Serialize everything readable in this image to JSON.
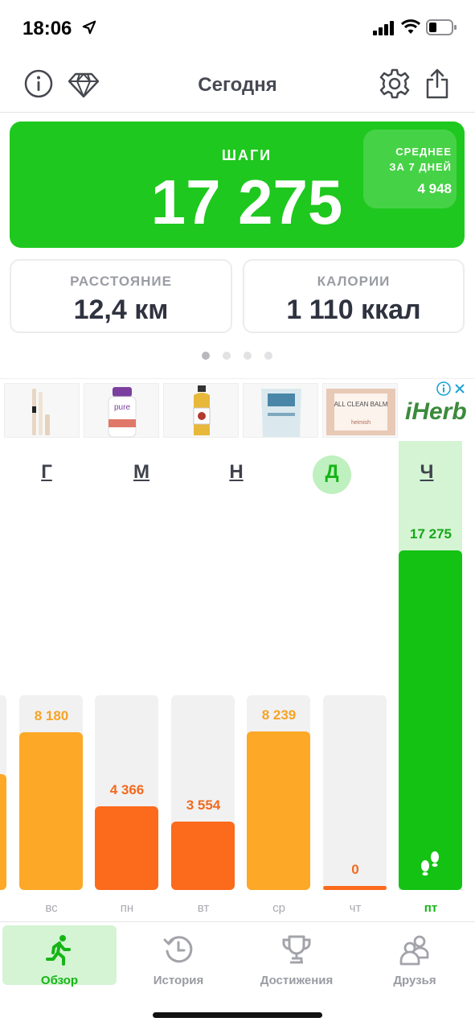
{
  "status_bar": {
    "time": "18:06"
  },
  "nav": {
    "title": "Сегодня"
  },
  "steps": {
    "label": "ШАГИ",
    "value": "17 275",
    "avg_label_line1": "СРЕДНЕЕ",
    "avg_label_line2": "ЗА 7 ДНЕЙ",
    "avg_value": "4 948"
  },
  "stats": [
    {
      "label": "РАССТОЯНИЕ",
      "value": "12,4 км"
    },
    {
      "label": "КАЛОРИИ",
      "value": "1 110 ккал"
    }
  ],
  "pager": {
    "pages": 4,
    "active_index": 0
  },
  "ad": {
    "brand": "iHerb",
    "product_texts": [
      "pure",
      "ALL CLEAN BALM",
      "heimish"
    ]
  },
  "chart": {
    "week_letters": [
      "Г",
      "М",
      "Н",
      "Д",
      "Ч"
    ],
    "highlighted_letter_index": 3
  },
  "chart_data": {
    "type": "bar",
    "categories": [
      "вс",
      "пн",
      "вт",
      "ср",
      "чт",
      "пт"
    ],
    "values": [
      8180,
      4366,
      3554,
      8239,
      0,
      17275
    ],
    "value_labels": [
      "8 180",
      "4 366",
      "3 554",
      "8 239",
      "0",
      "17 275"
    ],
    "highlight_category": "пт",
    "ylim": [
      0,
      17275
    ]
  },
  "tabs": [
    {
      "label": "Обзор",
      "icon": "runner-icon",
      "active": true
    },
    {
      "label": "История",
      "icon": "history-icon",
      "active": false
    },
    {
      "label": "Достижения",
      "icon": "trophy-icon",
      "active": false
    },
    {
      "label": "Друзья",
      "icon": "friends-icon",
      "active": false
    }
  ],
  "colors": {
    "accent_green": "#1ec81e",
    "bar_high": "#fda826",
    "bar_low": "#fc6a1c",
    "bar_today": "#13c213",
    "label_high": "#f6a325",
    "label_low": "#f26a1e"
  }
}
